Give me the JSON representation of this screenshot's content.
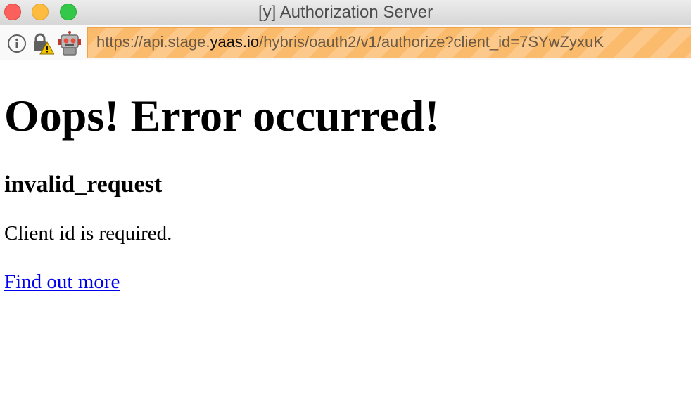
{
  "window": {
    "title": "[y] Authorization Server"
  },
  "address_bar": {
    "url_prefix": "https://api.stage.",
    "url_host": "yaas.io",
    "url_path": "/hybris/oauth2/v1/authorize?client_id=7SYwZyxuK"
  },
  "icons": {
    "info": "info-circle-icon",
    "lock": "insecure-lock-warning-icon",
    "extension": "robot-icon"
  },
  "page": {
    "heading": "Oops! Error occurred!",
    "error_code": "invalid_request",
    "message": "Client id is required.",
    "link_label": "Find out more"
  },
  "colors": {
    "link": "#0000ee",
    "url_bar_highlight": "#fbbb6c",
    "close": "#fc605c",
    "minimize": "#fdbc40",
    "maximize": "#34c84a"
  }
}
